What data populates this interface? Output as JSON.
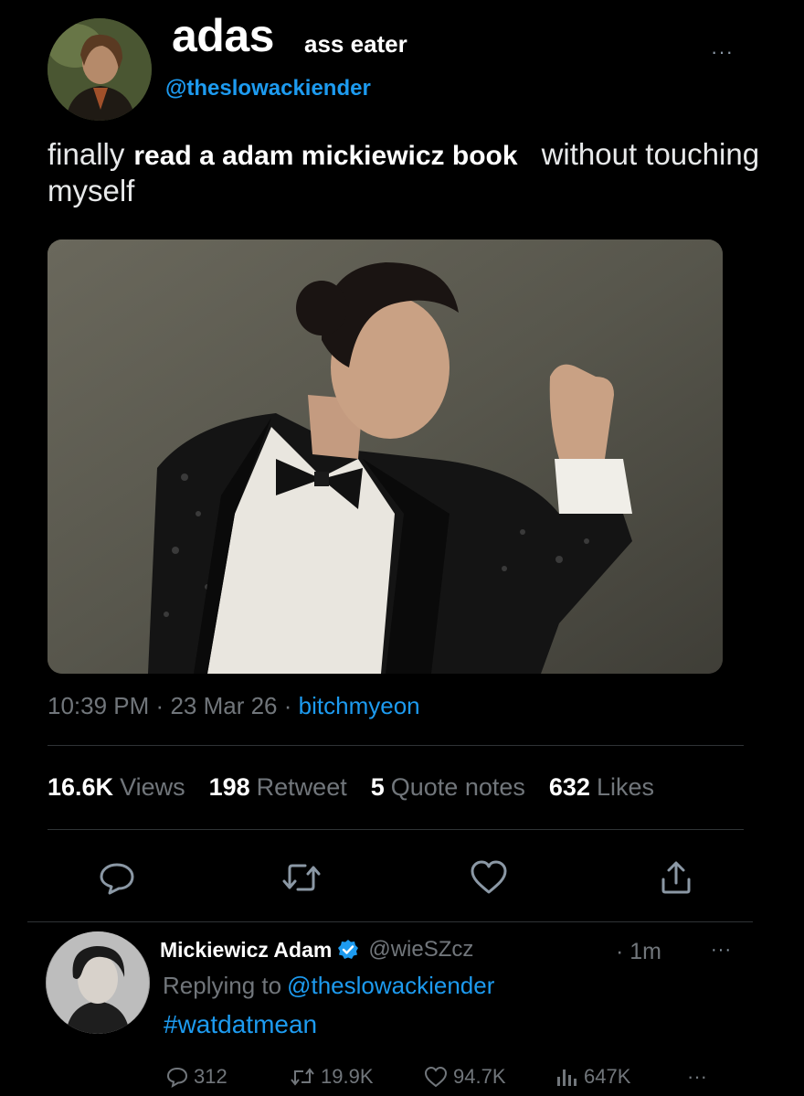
{
  "tweet": {
    "display_name": "adas",
    "name_suffix": "ass eater",
    "handle": "@theslowackiender",
    "more_label": "···",
    "text_before": "finally",
    "text_bold": "read a adam mickiewicz book",
    "text_after": "without touching myself",
    "meta": {
      "time": "10:39 PM",
      "sep1": "·",
      "date": "23 Mar 26",
      "sep2": "·",
      "source": "bitchmyeon"
    },
    "stats": [
      {
        "value": "16.6K",
        "label": "Views"
      },
      {
        "value": "198",
        "label": "Retweet"
      },
      {
        "value": "5",
        "label": "Quote notes"
      },
      {
        "value": "632",
        "label": "Likes"
      }
    ],
    "actions": [
      "reply-icon",
      "retweet-icon",
      "like-icon",
      "share-icon"
    ]
  },
  "reply": {
    "name": "Mickiewicz Adam",
    "handle": "@wieSZcz",
    "time": "· 1m",
    "more_label": "···",
    "replying_prefix": "Replying to",
    "replying_to": "@theslowackiender",
    "hashtag": "#watdatmean",
    "counts": {
      "replies": "312",
      "retweets": "19.9K",
      "likes": "94.7K",
      "views": "647K"
    },
    "more_small": "···"
  },
  "colors": {
    "background": "#000000",
    "accent": "#1d9bf0",
    "muted": "#71767b",
    "text": "#e7e9ea"
  }
}
